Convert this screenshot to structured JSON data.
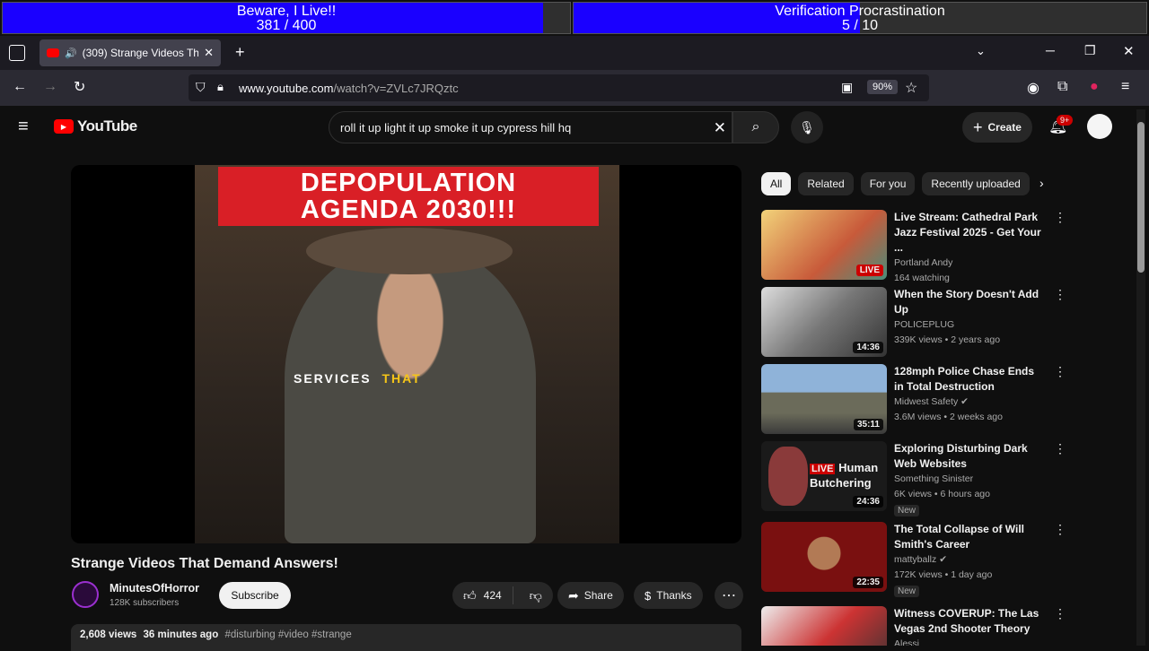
{
  "overlay": {
    "bar1": {
      "title": "Beware, I Live!!",
      "count": "381 / 400",
      "progress": 0.9525
    },
    "bar2": {
      "title": "Verification Procrastination",
      "count": "5 / 10",
      "progress": 0.5
    }
  },
  "browser": {
    "tab_title": "(309) Strange Videos That D",
    "url_host": "www.youtube.com",
    "url_path": "/watch?v=ZVLc7JRQztc",
    "zoom": "90%"
  },
  "youtube": {
    "logo_text": "YouTube",
    "search_value": "roll it up light it up smoke it up cypress hill hq",
    "create_label": "Create",
    "notif_badge": "9+",
    "video": {
      "banner_line1": "DEPOPULATION",
      "banner_line2": "AGENDA 2030!!!",
      "caption_a": "SERVICES",
      "caption_b": "THAT",
      "title": "Strange Videos That Demand Answers!",
      "channel": "MinutesOfHorror",
      "subscribers": "128K subscribers",
      "subscribe_label": "Subscribe",
      "likes": "424",
      "share_label": "Share",
      "thanks_label": "Thanks",
      "views": "2,608 views",
      "age": "36 minutes ago",
      "hashtags": "#disturbing #video #strange"
    },
    "chips": [
      "All",
      "Related",
      "For you",
      "Recently uploaded"
    ],
    "recs": [
      {
        "title": "Live Stream: Cathedral Park Jazz Festival 2025 - Get Your ...",
        "channel": "Portland Andy",
        "meta": "164 watching",
        "badge": "LIVE",
        "duration": ""
      },
      {
        "title": "When the Story Doesn't Add Up",
        "channel": "POLICEPLUG",
        "meta": "339K views • 2 years ago",
        "badge": "",
        "duration": "14:36"
      },
      {
        "title": "128mph Police Chase Ends in Total Destruction",
        "channel": "Midwest Safety",
        "meta": "3.6M views • 2 weeks ago",
        "badge": "",
        "duration": "35:11"
      },
      {
        "title": "Exploring Disturbing Dark Web Websites",
        "channel": "Something Sinister",
        "meta": "6K views • 6 hours ago",
        "badge": "New",
        "duration": "24:36",
        "thumb_text1": "LIVE",
        "thumb_text2": "Human",
        "thumb_text3": "Butchering"
      },
      {
        "title": "The Total Collapse of Will Smith's Career",
        "channel": "mattyballz",
        "meta": "172K views • 1 day ago",
        "badge": "New",
        "duration": "22:35"
      },
      {
        "title": "Witness COVERUP: The Las Vegas 2nd Shooter Theory",
        "channel": "Alessi",
        "meta": "",
        "badge": "",
        "duration": ""
      }
    ]
  }
}
